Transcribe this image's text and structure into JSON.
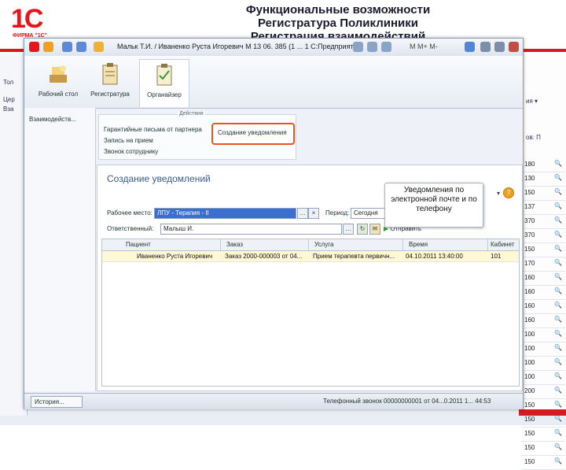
{
  "slide": {
    "logo_text": "1С",
    "logo_sub": "ФИРМА \"1С\"",
    "title_line1": "Функциональные возможности",
    "title_line2": "Регистратура Поликлиники",
    "title_line3": "Регистрация взаимодействий",
    "colors": {
      "brand_red": "#d61a1f",
      "highlight": "#e8541f"
    }
  },
  "background_window": {
    "left_labels": [
      "Тол",
      "Цер",
      "Вза"
    ],
    "right_rows": [
      "180",
      "130",
      "150",
      "137",
      "370",
      "370",
      "150",
      "170",
      "160",
      "160",
      "160",
      "160",
      "100",
      "100",
      "100",
      "100",
      "200",
      "150",
      "150",
      "150",
      "150",
      "150"
    ],
    "right_top_labels": [
      "ия ▾",
      "ов: П"
    ]
  },
  "window": {
    "title": "Мальк Т.И. / Иваненко Руста Игоревич М 13 06. 385 (1 ... 1 С:Предприятие)",
    "title_right": "M  M+  M-",
    "sections": [
      {
        "label": "Рабочий стол",
        "icon": "desk-icon"
      },
      {
        "label": "Регистратура",
        "icon": "clipboard-icon"
      },
      {
        "label": "Органайзер",
        "icon": "organizer-icon"
      }
    ],
    "nav_item": "Взаимодейств...",
    "actions_header": "Действия",
    "actions": [
      "Гарантийные письма от партнера",
      "Запись на прием",
      "Звонок сотруднику"
    ],
    "highlighted_action": "Создание уведомления",
    "form": {
      "title": "Создание уведомлений",
      "workplace_label": "Рабочее место:",
      "workplace_value": "ЛПУ - Терапия - II",
      "period_label": "Период:",
      "period_value": "Сегодня",
      "responsible_label": "Ответственный:",
      "responsible_value": "Малыш И.",
      "send_label": "Отправить",
      "tooltip": "Уведомления по электронной почте и по телефону",
      "columns": [
        "Пациент",
        "Заказ",
        "Услуга",
        "Время",
        "Кабинет"
      ],
      "rows": [
        [
          "Иваненко Руста Игоревич",
          "Заказ 2000-000003 от 04...",
          "Прием терапевта первичн...",
          "04.10.2011 13:40:00",
          "101"
        ]
      ]
    },
    "status": {
      "history_label": "История...",
      "status_text": "Телефонный звонок 00000000001 от 04...0.2011 1... 44:53"
    }
  }
}
